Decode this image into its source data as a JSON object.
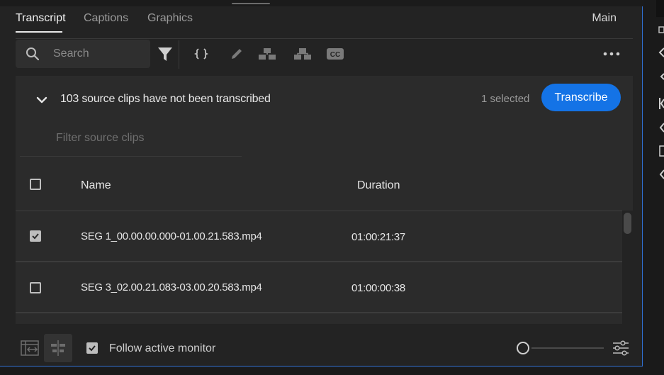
{
  "tabs": [
    {
      "label": "Transcript",
      "active": true
    },
    {
      "label": "Captions",
      "active": false
    },
    {
      "label": "Graphics",
      "active": false
    }
  ],
  "workspace_label": "Main",
  "search": {
    "placeholder": "Search"
  },
  "toolbar_icons": [
    "filter-icon",
    "merge-segments-icon",
    "edit-icon",
    "split-speaker-icon",
    "speakers-icon",
    "captions-icon",
    "more-icon"
  ],
  "source_clips": {
    "message": "103 source clips have not been transcribed",
    "selected_text": "1 selected",
    "transcribe_label": "Transcribe",
    "filter_placeholder": "Filter source clips"
  },
  "table": {
    "columns": [
      "Name",
      "Duration"
    ],
    "rows": [
      {
        "checked": true,
        "name": "SEG 1_00.00.00.000-01.00.21.583.mp4",
        "duration": "01:00:21:37"
      },
      {
        "checked": false,
        "name": "SEG 3_02.00.21.083-03.00.20.583.mp4",
        "duration": "01:00:00:38"
      }
    ]
  },
  "footer": {
    "follow_label": "Follow active monitor",
    "follow_checked": true,
    "zoom_level": 0
  },
  "colors": {
    "accent": "#1473e6",
    "panel_bg": "#232323",
    "content_bg": "#2b2b2b"
  }
}
